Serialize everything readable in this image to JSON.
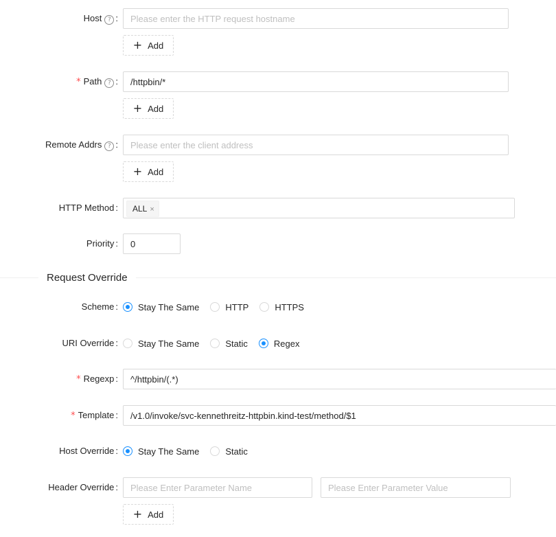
{
  "colors": {
    "primary": "#1890ff",
    "required": "#ff4d4f",
    "border": "#d9d9d9",
    "placeholder": "#bfbfbf"
  },
  "host": {
    "label": "Host",
    "help_icon": "question-circle-icon",
    "placeholder": "Please enter the HTTP request hostname",
    "value": "",
    "add_label": "Add"
  },
  "path": {
    "label": "Path",
    "required": true,
    "placeholder": "",
    "value": "/httpbin/*",
    "add_label": "Add"
  },
  "remote_addrs": {
    "label": "Remote Addrs",
    "placeholder": "Please enter the client address",
    "value": "",
    "add_label": "Add"
  },
  "http_method": {
    "label": "HTTP Method",
    "selected": [
      "ALL"
    ],
    "remove_glyph": "×"
  },
  "priority": {
    "label": "Priority",
    "value": "0"
  },
  "request_override": {
    "title": "Request Override",
    "scheme": {
      "label": "Scheme",
      "options": [
        "Stay The Same",
        "HTTP",
        "HTTPS"
      ],
      "selected": "Stay The Same"
    },
    "uri_override": {
      "label": "URI Override",
      "options": [
        "Stay The Same",
        "Static",
        "Regex"
      ],
      "selected": "Regex"
    },
    "regexp": {
      "label": "Regexp",
      "required": true,
      "value": "^/httpbin/(.*)"
    },
    "template": {
      "label": "Template",
      "required": true,
      "value": "/v1.0/invoke/svc-kennethreitz-httpbin.kind-test/method/$1"
    },
    "host_override": {
      "label": "Host Override",
      "options": [
        "Stay The Same",
        "Static"
      ],
      "selected": "Stay The Same"
    },
    "header_override": {
      "label": "Header Override",
      "name_placeholder": "Please Enter Parameter Name",
      "value_placeholder": "Please Enter Parameter Value",
      "add_label": "Add"
    }
  },
  "common": {
    "colon": ":",
    "required_mark": "*",
    "help_glyph": "?",
    "plus_glyph": "+"
  }
}
